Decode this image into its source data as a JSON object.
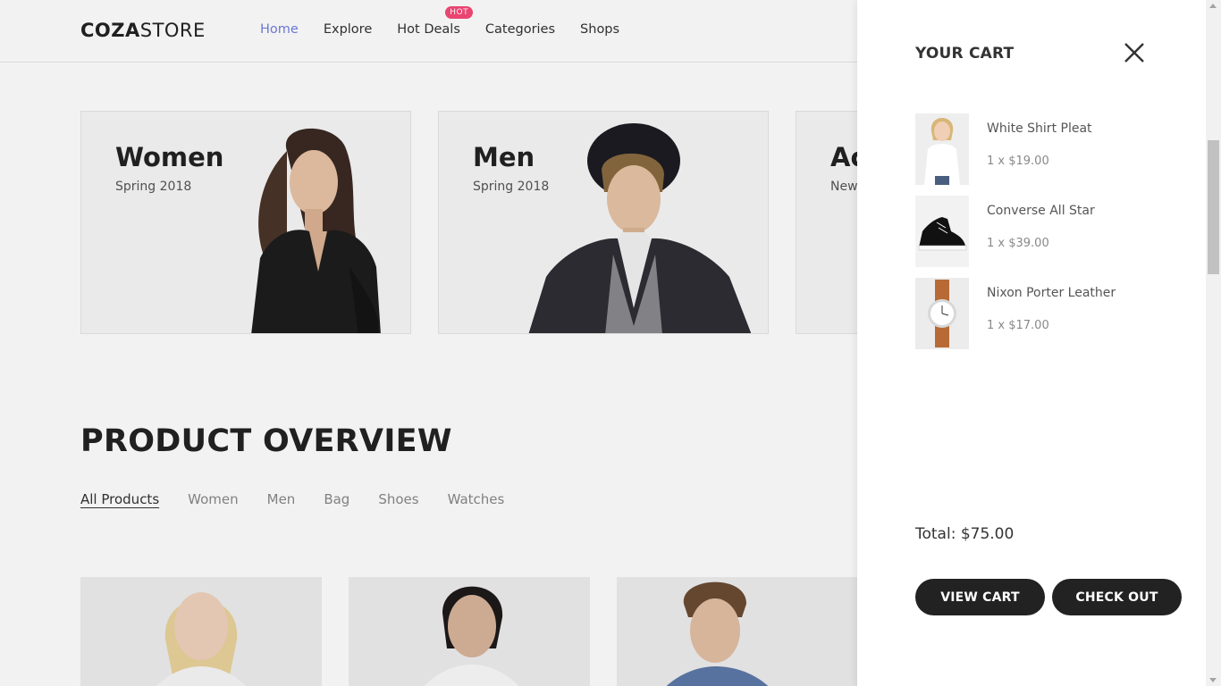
{
  "header": {
    "logo_bold": "COZA",
    "logo_light": "STORE",
    "nav": [
      {
        "label": "Home"
      },
      {
        "label": "Explore"
      },
      {
        "label": "Hot Deals",
        "badge": "HOT"
      },
      {
        "label": "Categories"
      },
      {
        "label": "Shops"
      }
    ]
  },
  "banners": [
    {
      "title": "Women",
      "subtitle": "Spring 2018"
    },
    {
      "title": "Men",
      "subtitle": "Spring 2018"
    },
    {
      "title": "Ac",
      "subtitle": "New"
    }
  ],
  "overview": {
    "title": "PRODUCT OVERVIEW",
    "filters": [
      "All Products",
      "Women",
      "Men",
      "Bag",
      "Shoes",
      "Watches"
    ]
  },
  "cart": {
    "title": "YOUR CART",
    "items": [
      {
        "name": "White Shirt Pleat",
        "price": "1 x $19.00"
      },
      {
        "name": "Converse All Star",
        "price": "1 x $39.00"
      },
      {
        "name": "Nixon Porter Leather",
        "price": "1 x $17.00"
      }
    ],
    "total": "Total: $75.00",
    "view_cart": "VIEW CART",
    "check_out": "CHECK OUT"
  },
  "colors": {
    "accent": "#717fe0",
    "hot_badge": "#f74877",
    "button": "#222222"
  }
}
